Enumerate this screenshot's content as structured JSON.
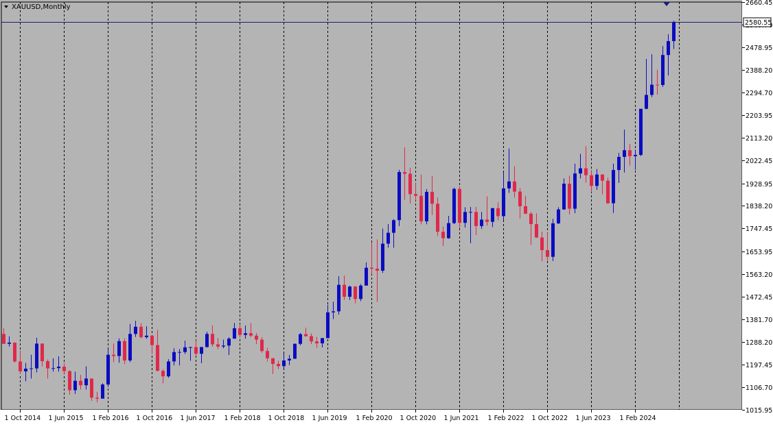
{
  "window": {
    "title": "XAUUSD,Monthly"
  },
  "colors": {
    "background": "#b4b4b4",
    "bull": "#0b0bc2",
    "bear": "#e0284a",
    "grid": "#000000",
    "price_line": "#1c1c7c",
    "frame": "#000000"
  },
  "chart_data": {
    "type": "candlestick",
    "symbol": "XAUUSD",
    "timeframe": "Monthly",
    "title": "XAUUSD,Monthly",
    "current_price": 2580.55,
    "ylim": [
      1015.95,
      2660.45
    ],
    "y_ticks": [
      "2660.45",
      "2569.70",
      "2478.95",
      "2388.20",
      "2294.70",
      "2203.95",
      "2113.20",
      "2022.45",
      "1928.95",
      "1838.20",
      "1747.45",
      "1653.95",
      "1563.20",
      "1472.45",
      "1381.70",
      "1288.20",
      "1197.45",
      "1106.70",
      "1015.95"
    ],
    "x_labels": [
      "1 Oct 2014",
      "1 Jun 2015",
      "1 Feb 2016",
      "1 Oct 2016",
      "1 Jun 2017",
      "1 Feb 2018",
      "1 Oct 2018",
      "1 Jun 2019",
      "1 Feb 2020",
      "1 Oct 2020",
      "1 Jun 2021",
      "1 Feb 2022",
      "1 Oct 2022",
      "1 Jun 2023",
      "1 Feb 2024"
    ],
    "grid": "vertical dashed",
    "candles": [
      {
        "date": "2014-07",
        "o": 1322,
        "h": 1345,
        "l": 1282,
        "c": 1282
      },
      {
        "date": "2014-08",
        "o": 1282,
        "h": 1312,
        "l": 1271,
        "c": 1287
      },
      {
        "date": "2014-09",
        "o": 1287,
        "h": 1288,
        "l": 1206,
        "c": 1211
      },
      {
        "date": "2014-10",
        "o": 1211,
        "h": 1255,
        "l": 1160,
        "c": 1171
      },
      {
        "date": "2014-11",
        "o": 1171,
        "h": 1205,
        "l": 1131,
        "c": 1182
      },
      {
        "date": "2014-12",
        "o": 1182,
        "h": 1238,
        "l": 1142,
        "c": 1183
      },
      {
        "date": "2015-01",
        "o": 1183,
        "h": 1307,
        "l": 1167,
        "c": 1283
      },
      {
        "date": "2015-02",
        "o": 1283,
        "h": 1284,
        "l": 1191,
        "c": 1212
      },
      {
        "date": "2015-03",
        "o": 1212,
        "h": 1219,
        "l": 1142,
        "c": 1183
      },
      {
        "date": "2015-04",
        "o": 1183,
        "h": 1224,
        "l": 1170,
        "c": 1184
      },
      {
        "date": "2015-05",
        "o": 1184,
        "h": 1232,
        "l": 1170,
        "c": 1190
      },
      {
        "date": "2015-06",
        "o": 1190,
        "h": 1205,
        "l": 1162,
        "c": 1172
      },
      {
        "date": "2015-07",
        "o": 1172,
        "h": 1175,
        "l": 1077,
        "c": 1095
      },
      {
        "date": "2015-08",
        "o": 1095,
        "h": 1170,
        "l": 1080,
        "c": 1133
      },
      {
        "date": "2015-09",
        "o": 1133,
        "h": 1157,
        "l": 1098,
        "c": 1115
      },
      {
        "date": "2015-10",
        "o": 1115,
        "h": 1191,
        "l": 1098,
        "c": 1142
      },
      {
        "date": "2015-11",
        "o": 1142,
        "h": 1142,
        "l": 1052,
        "c": 1065
      },
      {
        "date": "2015-12",
        "o": 1065,
        "h": 1088,
        "l": 1046,
        "c": 1061
      },
      {
        "date": "2016-01",
        "o": 1061,
        "h": 1123,
        "l": 1062,
        "c": 1118
      },
      {
        "date": "2016-02",
        "o": 1118,
        "h": 1263,
        "l": 1108,
        "c": 1238
      },
      {
        "date": "2016-03",
        "o": 1238,
        "h": 1283,
        "l": 1208,
        "c": 1233
      },
      {
        "date": "2016-04",
        "o": 1233,
        "h": 1304,
        "l": 1206,
        "c": 1293
      },
      {
        "date": "2016-05",
        "o": 1293,
        "h": 1304,
        "l": 1200,
        "c": 1215
      },
      {
        "date": "2016-06",
        "o": 1215,
        "h": 1362,
        "l": 1208,
        "c": 1322
      },
      {
        "date": "2016-07",
        "o": 1322,
        "h": 1375,
        "l": 1310,
        "c": 1351
      },
      {
        "date": "2016-08",
        "o": 1351,
        "h": 1366,
        "l": 1303,
        "c": 1309
      },
      {
        "date": "2016-09",
        "o": 1309,
        "h": 1353,
        "l": 1302,
        "c": 1315
      },
      {
        "date": "2016-10",
        "o": 1315,
        "h": 1316,
        "l": 1241,
        "c": 1277
      },
      {
        "date": "2016-11",
        "o": 1277,
        "h": 1338,
        "l": 1171,
        "c": 1173
      },
      {
        "date": "2016-12",
        "o": 1173,
        "h": 1180,
        "l": 1123,
        "c": 1151
      },
      {
        "date": "2017-01",
        "o": 1151,
        "h": 1220,
        "l": 1145,
        "c": 1211
      },
      {
        "date": "2017-02",
        "o": 1211,
        "h": 1264,
        "l": 1195,
        "c": 1249
      },
      {
        "date": "2017-03",
        "o": 1249,
        "h": 1261,
        "l": 1195,
        "c": 1249
      },
      {
        "date": "2017-04",
        "o": 1249,
        "h": 1295,
        "l": 1241,
        "c": 1268
      },
      {
        "date": "2017-05",
        "o": 1268,
        "h": 1270,
        "l": 1214,
        "c": 1269
      },
      {
        "date": "2017-06",
        "o": 1269,
        "h": 1296,
        "l": 1236,
        "c": 1242
      },
      {
        "date": "2017-07",
        "o": 1242,
        "h": 1270,
        "l": 1204,
        "c": 1269
      },
      {
        "date": "2017-08",
        "o": 1269,
        "h": 1331,
        "l": 1267,
        "c": 1322
      },
      {
        "date": "2017-09",
        "o": 1322,
        "h": 1357,
        "l": 1271,
        "c": 1280
      },
      {
        "date": "2017-10",
        "o": 1280,
        "h": 1306,
        "l": 1261,
        "c": 1271
      },
      {
        "date": "2017-11",
        "o": 1271,
        "h": 1299,
        "l": 1264,
        "c": 1275
      },
      {
        "date": "2017-12",
        "o": 1275,
        "h": 1309,
        "l": 1237,
        "c": 1303
      },
      {
        "date": "2018-01",
        "o": 1303,
        "h": 1366,
        "l": 1303,
        "c": 1345
      },
      {
        "date": "2018-02",
        "o": 1345,
        "h": 1361,
        "l": 1307,
        "c": 1318
      },
      {
        "date": "2018-03",
        "o": 1318,
        "h": 1356,
        "l": 1303,
        "c": 1325
      },
      {
        "date": "2018-04",
        "o": 1325,
        "h": 1366,
        "l": 1309,
        "c": 1315
      },
      {
        "date": "2018-05",
        "o": 1315,
        "h": 1326,
        "l": 1281,
        "c": 1299
      },
      {
        "date": "2018-06",
        "o": 1299,
        "h": 1309,
        "l": 1246,
        "c": 1253
      },
      {
        "date": "2018-07",
        "o": 1253,
        "h": 1266,
        "l": 1211,
        "c": 1224
      },
      {
        "date": "2018-08",
        "o": 1224,
        "h": 1224,
        "l": 1160,
        "c": 1201
      },
      {
        "date": "2018-09",
        "o": 1201,
        "h": 1214,
        "l": 1180,
        "c": 1192
      },
      {
        "date": "2018-10",
        "o": 1192,
        "h": 1243,
        "l": 1182,
        "c": 1215
      },
      {
        "date": "2018-11",
        "o": 1215,
        "h": 1237,
        "l": 1196,
        "c": 1222
      },
      {
        "date": "2018-12",
        "o": 1222,
        "h": 1284,
        "l": 1221,
        "c": 1282
      },
      {
        "date": "2019-01",
        "o": 1282,
        "h": 1326,
        "l": 1276,
        "c": 1321
      },
      {
        "date": "2019-02",
        "o": 1321,
        "h": 1347,
        "l": 1311,
        "c": 1313
      },
      {
        "date": "2019-03",
        "o": 1313,
        "h": 1324,
        "l": 1281,
        "c": 1292
      },
      {
        "date": "2019-04",
        "o": 1292,
        "h": 1310,
        "l": 1266,
        "c": 1284
      },
      {
        "date": "2019-05",
        "o": 1284,
        "h": 1306,
        "l": 1267,
        "c": 1305
      },
      {
        "date": "2019-06",
        "o": 1305,
        "h": 1439,
        "l": 1305,
        "c": 1409
      },
      {
        "date": "2019-07",
        "o": 1409,
        "h": 1452,
        "l": 1382,
        "c": 1413
      },
      {
        "date": "2019-08",
        "o": 1413,
        "h": 1555,
        "l": 1400,
        "c": 1520
      },
      {
        "date": "2019-09",
        "o": 1520,
        "h": 1557,
        "l": 1459,
        "c": 1472
      },
      {
        "date": "2019-10",
        "o": 1472,
        "h": 1517,
        "l": 1459,
        "c": 1513
      },
      {
        "date": "2019-11",
        "o": 1513,
        "h": 1515,
        "l": 1445,
        "c": 1463
      },
      {
        "date": "2019-12",
        "o": 1463,
        "h": 1523,
        "l": 1454,
        "c": 1517
      },
      {
        "date": "2020-01",
        "o": 1517,
        "h": 1611,
        "l": 1517,
        "c": 1589
      },
      {
        "date": "2020-02",
        "o": 1589,
        "h": 1689,
        "l": 1563,
        "c": 1585
      },
      {
        "date": "2020-03",
        "o": 1585,
        "h": 1703,
        "l": 1451,
        "c": 1577
      },
      {
        "date": "2020-04",
        "o": 1577,
        "h": 1747,
        "l": 1568,
        "c": 1686
      },
      {
        "date": "2020-05",
        "o": 1686,
        "h": 1765,
        "l": 1670,
        "c": 1730
      },
      {
        "date": "2020-06",
        "o": 1730,
        "h": 1785,
        "l": 1670,
        "c": 1781
      },
      {
        "date": "2020-07",
        "o": 1781,
        "h": 1984,
        "l": 1757,
        "c": 1975
      },
      {
        "date": "2020-08",
        "o": 1975,
        "h": 2075,
        "l": 1863,
        "c": 1968
      },
      {
        "date": "2020-09",
        "o": 1968,
        "h": 1992,
        "l": 1848,
        "c": 1886
      },
      {
        "date": "2020-10",
        "o": 1886,
        "h": 1933,
        "l": 1860,
        "c": 1879
      },
      {
        "date": "2020-11",
        "o": 1879,
        "h": 1965,
        "l": 1764,
        "c": 1776
      },
      {
        "date": "2020-12",
        "o": 1776,
        "h": 1906,
        "l": 1764,
        "c": 1895
      },
      {
        "date": "2021-01",
        "o": 1895,
        "h": 1959,
        "l": 1802,
        "c": 1847
      },
      {
        "date": "2021-02",
        "o": 1847,
        "h": 1872,
        "l": 1717,
        "c": 1734
      },
      {
        "date": "2021-03",
        "o": 1734,
        "h": 1755,
        "l": 1677,
        "c": 1708
      },
      {
        "date": "2021-04",
        "o": 1708,
        "h": 1798,
        "l": 1706,
        "c": 1769
      },
      {
        "date": "2021-05",
        "o": 1769,
        "h": 1912,
        "l": 1765,
        "c": 1907
      },
      {
        "date": "2021-06",
        "o": 1907,
        "h": 1917,
        "l": 1750,
        "c": 1770
      },
      {
        "date": "2021-07",
        "o": 1770,
        "h": 1833,
        "l": 1751,
        "c": 1814
      },
      {
        "date": "2021-08",
        "o": 1814,
        "h": 1834,
        "l": 1688,
        "c": 1814
      },
      {
        "date": "2021-09",
        "o": 1814,
        "h": 1834,
        "l": 1721,
        "c": 1757
      },
      {
        "date": "2021-10",
        "o": 1757,
        "h": 1814,
        "l": 1746,
        "c": 1783
      },
      {
        "date": "2021-11",
        "o": 1783,
        "h": 1877,
        "l": 1759,
        "c": 1774
      },
      {
        "date": "2021-12",
        "o": 1774,
        "h": 1831,
        "l": 1753,
        "c": 1829
      },
      {
        "date": "2022-01",
        "o": 1829,
        "h": 1853,
        "l": 1780,
        "c": 1797
      },
      {
        "date": "2022-02",
        "o": 1797,
        "h": 1974,
        "l": 1781,
        "c": 1909
      },
      {
        "date": "2022-03",
        "o": 1909,
        "h": 2070,
        "l": 1891,
        "c": 1937
      },
      {
        "date": "2022-04",
        "o": 1937,
        "h": 1998,
        "l": 1872,
        "c": 1896
      },
      {
        "date": "2022-05",
        "o": 1896,
        "h": 1910,
        "l": 1787,
        "c": 1837
      },
      {
        "date": "2022-06",
        "o": 1837,
        "h": 1879,
        "l": 1805,
        "c": 1807
      },
      {
        "date": "2022-07",
        "o": 1807,
        "h": 1814,
        "l": 1681,
        "c": 1765
      },
      {
        "date": "2022-08",
        "o": 1765,
        "h": 1808,
        "l": 1709,
        "c": 1711
      },
      {
        "date": "2022-09",
        "o": 1711,
        "h": 1735,
        "l": 1615,
        "c": 1660
      },
      {
        "date": "2022-10",
        "o": 1660,
        "h": 1730,
        "l": 1617,
        "c": 1633
      },
      {
        "date": "2022-11",
        "o": 1633,
        "h": 1786,
        "l": 1616,
        "c": 1768
      },
      {
        "date": "2022-12",
        "o": 1768,
        "h": 1833,
        "l": 1765,
        "c": 1824
      },
      {
        "date": "2023-01",
        "o": 1824,
        "h": 1949,
        "l": 1823,
        "c": 1928
      },
      {
        "date": "2023-02",
        "o": 1928,
        "h": 1960,
        "l": 1804,
        "c": 1827
      },
      {
        "date": "2023-03",
        "o": 1827,
        "h": 2009,
        "l": 1809,
        "c": 1969
      },
      {
        "date": "2023-04",
        "o": 1969,
        "h": 2048,
        "l": 1949,
        "c": 1990
      },
      {
        "date": "2023-05",
        "o": 1990,
        "h": 2079,
        "l": 1932,
        "c": 1962
      },
      {
        "date": "2023-06",
        "o": 1962,
        "h": 1983,
        "l": 1893,
        "c": 1919
      },
      {
        "date": "2023-07",
        "o": 1919,
        "h": 1987,
        "l": 1903,
        "c": 1965
      },
      {
        "date": "2023-08",
        "o": 1965,
        "h": 1966,
        "l": 1885,
        "c": 1940
      },
      {
        "date": "2023-09",
        "o": 1940,
        "h": 1953,
        "l": 1846,
        "c": 1849
      },
      {
        "date": "2023-10",
        "o": 1849,
        "h": 2009,
        "l": 1810,
        "c": 1983
      },
      {
        "date": "2023-11",
        "o": 1983,
        "h": 2052,
        "l": 1931,
        "c": 2036
      },
      {
        "date": "2023-12",
        "o": 2036,
        "h": 2146,
        "l": 1973,
        "c": 2063
      },
      {
        "date": "2024-01",
        "o": 2063,
        "h": 2088,
        "l": 2001,
        "c": 2039
      },
      {
        "date": "2024-02",
        "o": 2039,
        "h": 2065,
        "l": 1984,
        "c": 2044
      },
      {
        "date": "2024-03",
        "o": 2044,
        "h": 2222,
        "l": 2039,
        "c": 2230
      },
      {
        "date": "2024-04",
        "o": 2230,
        "h": 2431,
        "l": 2228,
        "c": 2286
      },
      {
        "date": "2024-05",
        "o": 2286,
        "h": 2450,
        "l": 2277,
        "c": 2327
      },
      {
        "date": "2024-06",
        "o": 2327,
        "h": 2388,
        "l": 2287,
        "c": 2326
      },
      {
        "date": "2024-07",
        "o": 2326,
        "h": 2483,
        "l": 2318,
        "c": 2447
      },
      {
        "date": "2024-08",
        "o": 2447,
        "h": 2531,
        "l": 2364,
        "c": 2503
      },
      {
        "date": "2024-09",
        "o": 2503,
        "h": 2585,
        "l": 2471,
        "c": 2580.55
      }
    ]
  }
}
